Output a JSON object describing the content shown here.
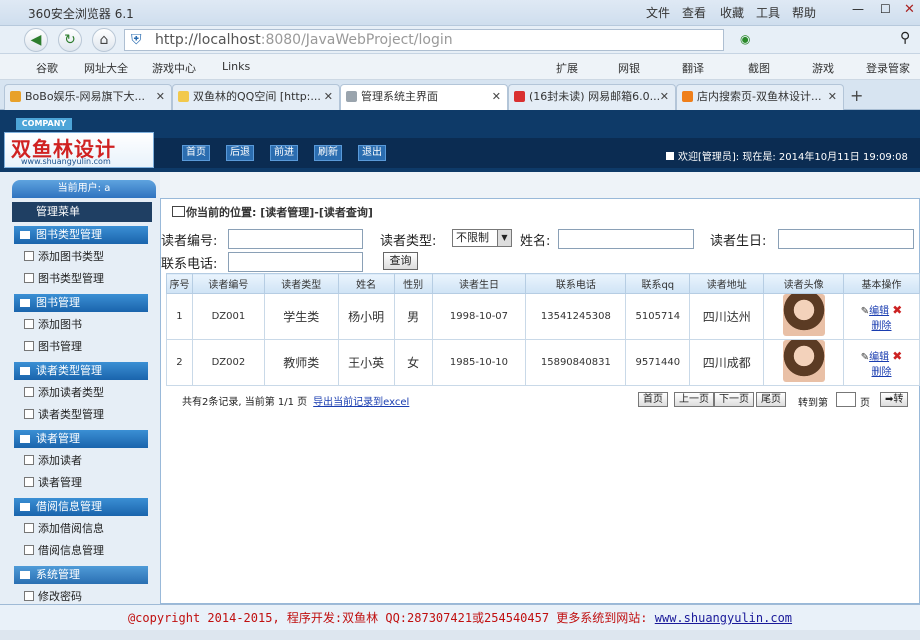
{
  "browser": {
    "title": "360安全浏览器 6.1",
    "menus": [
      "文件",
      "查看",
      "收藏",
      "工具",
      "帮助"
    ],
    "url_host": "http://localhost",
    "url_rest": ":8080/JavaWebProject/login",
    "bookmarks": [
      "谷歌",
      "网址大全",
      "游戏中心",
      "Links",
      "扩展",
      "网银",
      "翻译",
      "截图",
      "游戏",
      "登录管家"
    ],
    "tabs": [
      {
        "label": "BoBo娱乐-网易旗下大...",
        "color": "#e8a12a"
      },
      {
        "label": "双鱼林的QQ空间 [http:...",
        "color": "#f2c94c"
      },
      {
        "label": "管理系统主界面",
        "color": "#9aa4ad"
      },
      {
        "label": "(16封未读) 网易邮箱6.0...",
        "color": "#d93030"
      },
      {
        "label": "店内搜索页-双鱼林设计...",
        "color": "#ef7f1a"
      }
    ],
    "active_tab_index": 2
  },
  "header": {
    "company": "COMPANY",
    "logo_name": "双鱼林设计",
    "logo_url": "www.shuangyulin.com",
    "nav": [
      "首页",
      "后退",
      "前进",
      "刷新",
      "退出"
    ],
    "welcome": "欢迎[管理员]: 现在是: 2014年10月11日 19:09:08"
  },
  "sidebar": {
    "current_user": "当前用户: a",
    "menu_title": "管理菜单",
    "groups": [
      {
        "title": "图书类型管理",
        "items": [
          "添加图书类型",
          "图书类型管理"
        ]
      },
      {
        "title": "图书管理",
        "items": [
          "添加图书",
          "图书管理"
        ]
      },
      {
        "title": "读者类型管理",
        "items": [
          "添加读者类型",
          "读者类型管理"
        ]
      },
      {
        "title": "读者管理",
        "items": [
          "添加读者",
          "读者管理"
        ]
      },
      {
        "title": "借阅信息管理",
        "items": [
          "添加借阅信息",
          "借阅信息管理"
        ]
      },
      {
        "title": "系统管理",
        "items": [
          "修改密码"
        ]
      }
    ]
  },
  "main": {
    "location": "你当前的位置: [读者管理]-[读者查询]",
    "form": {
      "reader_no_label": "读者编号:",
      "reader_type_label": "读者类型:",
      "reader_type_value": "不限制",
      "name_label": "姓名:",
      "birthday_label": "读者生日:",
      "phone_label": "联系电话:",
      "query_button": "查询"
    },
    "table": {
      "columns": [
        "序号",
        "读者编号",
        "读者类型",
        "姓名",
        "性别",
        "读者生日",
        "联系电话",
        "联系qq",
        "读者地址",
        "读者头像",
        "基本操作"
      ],
      "rows": [
        {
          "no": "1",
          "reader_no": "DZ001",
          "type": "学生类",
          "name": "杨小明",
          "gender": "男",
          "birthday": "1998-10-07",
          "phone": "13541245308",
          "qq": "5105714",
          "address": "四川达州"
        },
        {
          "no": "2",
          "reader_no": "DZ002",
          "type": "教师类",
          "name": "王小英",
          "gender": "女",
          "birthday": "1985-10-10",
          "phone": "15890840831",
          "qq": "9571440",
          "address": "四川成都"
        }
      ],
      "edit_label": "编辑",
      "delete_label": "删除"
    },
    "pager": {
      "summary": "共有2条记录, 当前第 1/1 页",
      "export": "导出当前记录到excel",
      "first": "首页",
      "prev": "上一页",
      "next": "下一页",
      "last": "尾页",
      "goto": "转到第",
      "page_unit": "页",
      "go": "转"
    }
  },
  "footer": {
    "text": "@copyright 2014-2015, 程序开发:双鱼林  QQ:287307421或254540457  更多系统到网站:",
    "link": "www.shuangyulin.com"
  }
}
